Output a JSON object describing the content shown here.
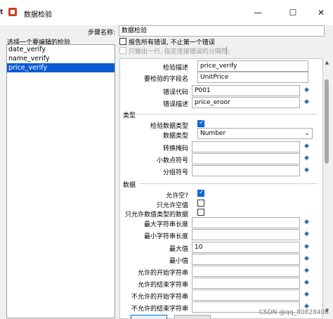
{
  "window": {
    "title": "数据检验",
    "minimize": "—",
    "maximize": "☐",
    "close": "✕"
  },
  "step_name": {
    "label": "步骤名称:",
    "value": "数据检验"
  },
  "list": {
    "label": "选择一个要编辑的检验",
    "items": [
      "date_verify",
      "name_verify",
      "price_verify"
    ],
    "selected": 2
  },
  "options": {
    "report_all": "报告所有错误, 不止第一个错误",
    "output_one_row": "只输出一行, 指定连接错误的分隔符:"
  },
  "form": {
    "verify_desc": {
      "label": "检验描述",
      "value": "price_verify"
    },
    "field_name": {
      "label": "要检验的字段名",
      "value": "UnitPrice"
    },
    "error_code": {
      "label": "错误代码",
      "value": "P001"
    },
    "error_desc": {
      "label": "错误描述",
      "value": "price_eroor"
    },
    "type_section": "类型",
    "verify_type": {
      "label": "检验数据类型"
    },
    "data_type": {
      "label": "数据类型",
      "value": "Number"
    },
    "conv_mask": {
      "label": "转换掩码"
    },
    "decimal": {
      "label": "小数点符号"
    },
    "grouping": {
      "label": "分组符号"
    },
    "data_section": "数据",
    "allow_null": {
      "label": "允许空?"
    },
    "only_null": {
      "label": "只允许空值"
    },
    "only_numeric": {
      "label": "只允许数值类型的数据"
    },
    "max_len": {
      "label": "最大字符串长度"
    },
    "min_len": {
      "label": "最小字符串长度"
    },
    "max_val": {
      "label": "最大值",
      "value": "10"
    },
    "min_val": {
      "label": "最小值"
    },
    "allow_start": {
      "label": "允许的开始字符串"
    },
    "allow_end": {
      "label": "允许的结束字符串"
    },
    "disallow_start": {
      "label": "不允许的开始字符串"
    },
    "disallow_end": {
      "label": "不允许的结束字符串"
    }
  },
  "watermark": "CSDN @qq_50828406"
}
